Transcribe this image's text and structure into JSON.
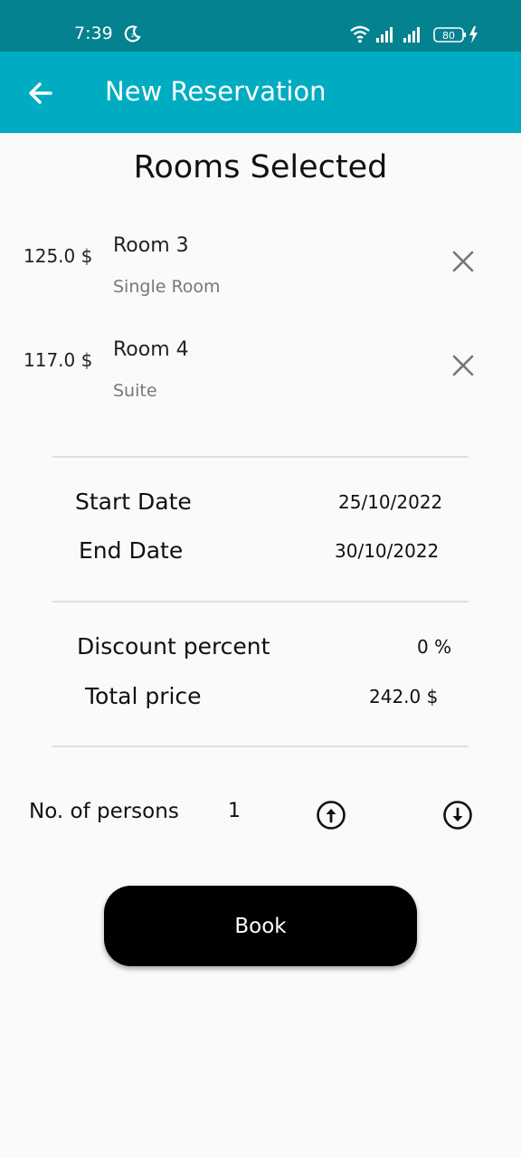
{
  "status_bar": {
    "time": "7:39",
    "battery": "80",
    "icons": [
      "moon-icon",
      "wifi-icon",
      "signal-icon",
      "signal-icon",
      "battery-icon",
      "charging-icon"
    ]
  },
  "app_bar": {
    "title": "New Reservation",
    "color": "#00acc1",
    "status_color": "#04828f"
  },
  "heading": "Rooms Selected",
  "rooms": [
    {
      "price": "125.0 $",
      "name": "Room 3",
      "type": "Single Room"
    },
    {
      "price": "117.0 $",
      "name": "Room 4",
      "type": "Suite"
    }
  ],
  "dates": {
    "start_label": "Start Date",
    "start_value": "25/10/2022",
    "end_label": "End Date",
    "end_value": "30/10/2022"
  },
  "pricing": {
    "discount_label": "Discount percent",
    "discount_value": "0 %",
    "total_label": "Total price",
    "total_value": "242.0 $"
  },
  "persons": {
    "label": "No. of persons",
    "count": "1"
  },
  "book_label": "Book"
}
